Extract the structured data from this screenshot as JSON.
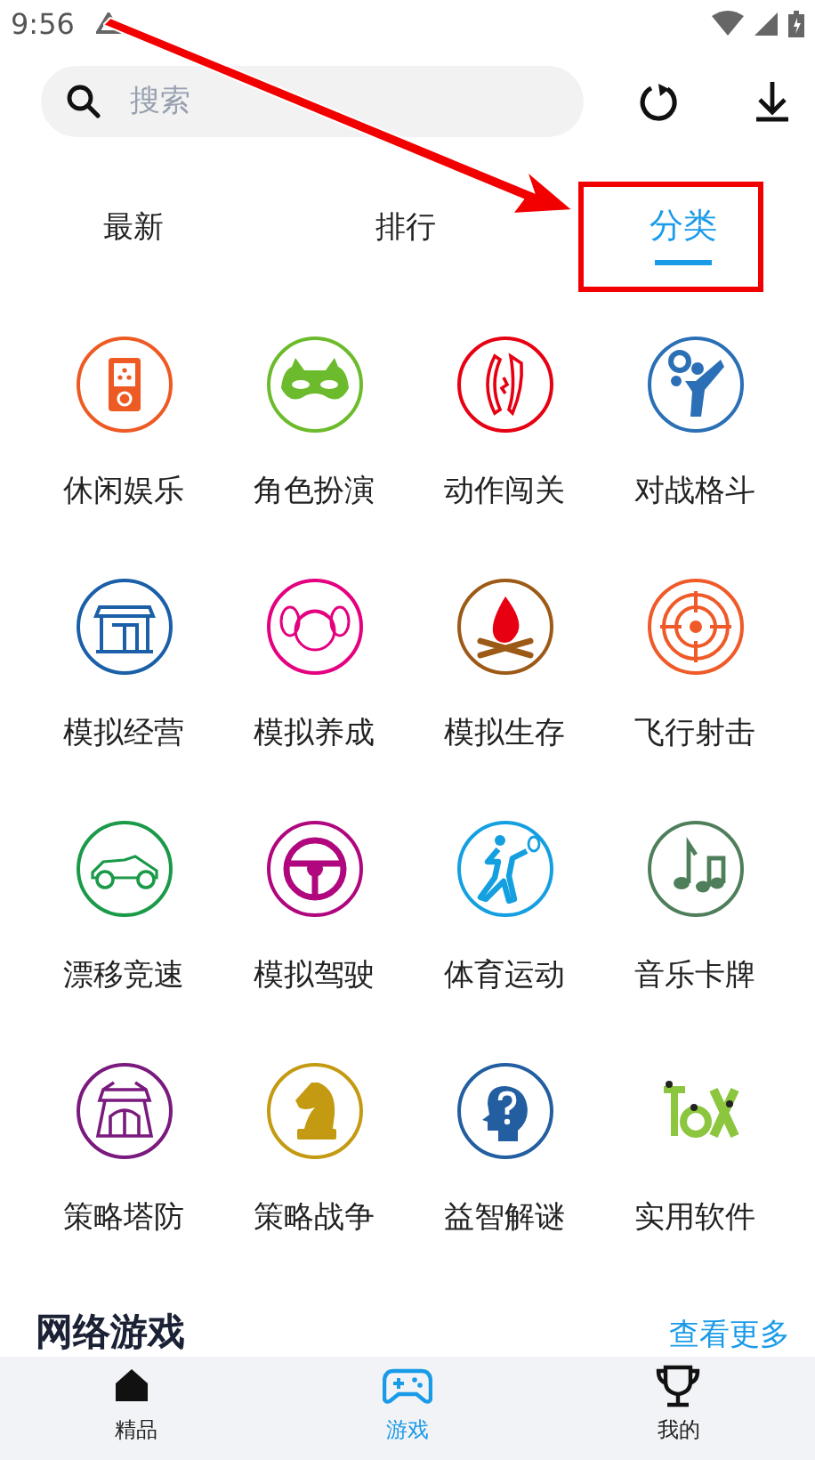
{
  "status_bar": {
    "time": "9:56"
  },
  "search": {
    "placeholder": "搜索"
  },
  "tabs": [
    {
      "label": "最新",
      "selected": false
    },
    {
      "label": "排行",
      "selected": false
    },
    {
      "label": "分类",
      "selected": true
    }
  ],
  "annotation": {
    "kind": "arrow"
  },
  "categories": [
    {
      "label": "休闲娱乐",
      "kind": "handheld",
      "color": "#ee5a24"
    },
    {
      "label": "角色扮演",
      "kind": "mask",
      "color": "#6cbb2c"
    },
    {
      "label": "动作闯关",
      "kind": "blades",
      "color": "#e60012"
    },
    {
      "label": "对战格斗",
      "kind": "kick",
      "color": "#2b6fb6"
    },
    {
      "label": "模拟经营",
      "kind": "shop",
      "color": "#1b5fa8"
    },
    {
      "label": "模拟养成",
      "kind": "girl",
      "color": "#e4007f"
    },
    {
      "label": "模拟生存",
      "kind": "campfire",
      "color": "#9c5a16"
    },
    {
      "label": "飞行射击",
      "kind": "target",
      "color": "#ef5a28"
    },
    {
      "label": "漂移竞速",
      "kind": "car",
      "color": "#1a9a48"
    },
    {
      "label": "模拟驾驶",
      "kind": "wheel",
      "color": "#b0067e"
    },
    {
      "label": "体育运动",
      "kind": "runner",
      "color": "#14a0e0"
    },
    {
      "label": "音乐卡牌",
      "kind": "music",
      "color": "#4f7f5a"
    },
    {
      "label": "策略塔防",
      "kind": "castle",
      "color": "#7a1a7e"
    },
    {
      "label": "策略战争",
      "kind": "knight",
      "color": "#c49a12"
    },
    {
      "label": "益智解谜",
      "kind": "head",
      "color": "#225ea0"
    },
    {
      "label": "实用软件",
      "kind": "bugs",
      "color": "#8cc63f"
    }
  ],
  "section": {
    "title": "网络游戏",
    "more": "查看更多"
  },
  "nav": [
    {
      "label": "精品",
      "kind": "home",
      "selected": false
    },
    {
      "label": "游戏",
      "kind": "gamepad",
      "selected": true
    },
    {
      "label": "我的",
      "kind": "trophy",
      "selected": false
    }
  ]
}
